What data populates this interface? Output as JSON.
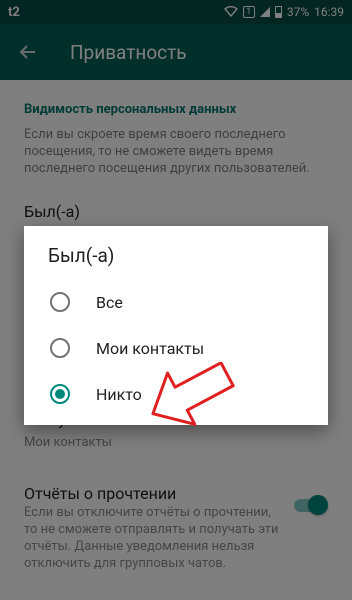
{
  "status_bar": {
    "carrier": "t2",
    "sim": "1",
    "battery": "37%",
    "time": "16:39"
  },
  "toolbar": {
    "back_icon": "arrow-left-icon",
    "title": "Приватность"
  },
  "section": {
    "header": "Видимость персональных данных",
    "description": "Если вы скроете время своего последнего посещения, то не сможете видеть время последнего посещения других пользователей."
  },
  "last_seen": {
    "title": "Был(-а)"
  },
  "status": {
    "title": "Статус",
    "value": "Мои контакты"
  },
  "read_receipts": {
    "title": "Отчёты о прочтении",
    "description": "Если вы отключите отчёты о прочтении, то не сможете отправлять и получать эти отчёты. Данные уведомления нельзя отключить для групповых чатов.",
    "enabled": true
  },
  "dialog": {
    "title": "Был(-а)",
    "options": [
      {
        "label": "Все",
        "selected": false
      },
      {
        "label": "Мои контакты",
        "selected": false
      },
      {
        "label": "Никто",
        "selected": true
      }
    ]
  },
  "colors": {
    "toolbar": "#075e54",
    "status_bar": "#064d44",
    "accent": "#00897b",
    "annotation_arrow": "#e02020"
  }
}
